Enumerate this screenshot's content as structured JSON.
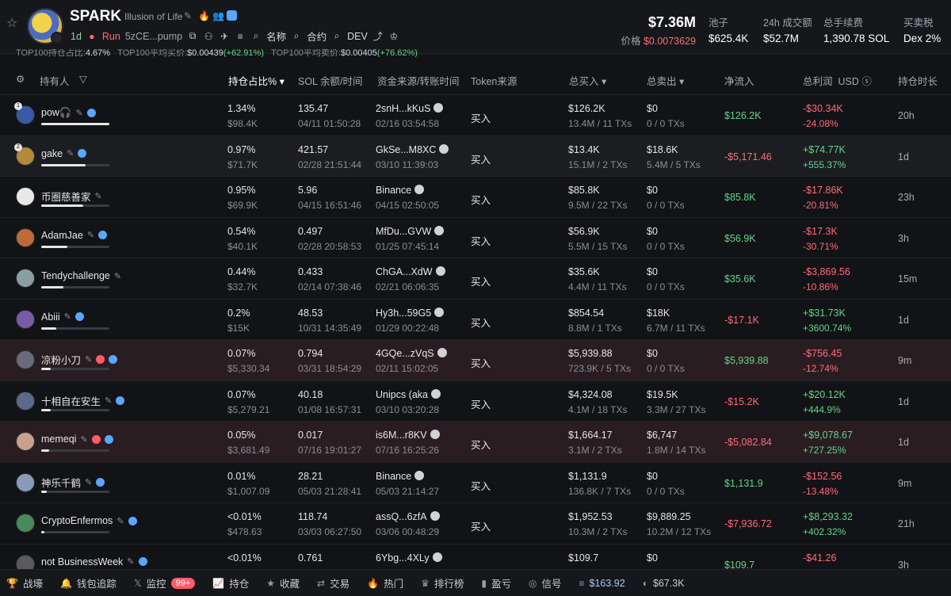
{
  "token": {
    "name": "SPARK",
    "subtitle": "Illusion of Life",
    "age": "1d",
    "run": "Run",
    "address": "5zCE...pump",
    "buttons": [
      "名称",
      "合约",
      "DEV"
    ]
  },
  "ticker_strip": {
    "part1_label": "TOP100持仓占比:",
    "part1_value": "4.67%",
    "part2_label": "TOP100平均买价:",
    "part2_value": "$0.00439",
    "part2_change": "(+62.91%)",
    "part3_label": "TOP100平均卖价:",
    "part3_value": "$0.00405",
    "part3_change": "(+76.62%)"
  },
  "market": {
    "mcap": "$7.36M",
    "price_label": "价格",
    "price": "$0.0073629",
    "stats": [
      {
        "label": "池子",
        "value": "$625.4K"
      },
      {
        "label": "24h 成交额",
        "value": "$52.7M"
      },
      {
        "label": "总手续费",
        "value": "1,390.78 SOL"
      },
      {
        "label": "买卖税",
        "value": "Dex 2%"
      }
    ]
  },
  "columns": {
    "holder": "持有人",
    "hold_pct": "持仓占比%",
    "sol_balance": "SOL 余额/时间",
    "fund_source": "资金来源/转账时间",
    "token_source": "Token来源",
    "total_buy": "总买入",
    "total_sell": "总卖出",
    "net_inflow": "净流入",
    "total_pnl": "总利润",
    "currency": "USD",
    "duration": "持仓时长"
  },
  "rows": [
    {
      "rank": "1",
      "name": "pow🎧",
      "pct": "1.34%",
      "pct_val": "$98.4K",
      "bar": 100,
      "sol": "135.47",
      "sol_time": "04/11 01:50:28",
      "src": "2snH...kKuS",
      "src_time": "02/16 03:54:58",
      "token_src": "买入",
      "buy": "$126.2K",
      "buy_sub": "13.4M / 11 TXs",
      "sell": "$0",
      "sell_sub": "0 / 0 TXs",
      "net": "$126.2K",
      "net_pos": true,
      "pnl": "-$30.34K",
      "pnl_pct": "-24.08%",
      "pnl_pos": false,
      "dur": "20h",
      "style": "",
      "avatar": "#3a5aa8",
      "red": false
    },
    {
      "rank": "2",
      "name": "gake",
      "pct": "0.97%",
      "pct_val": "$71.7K",
      "bar": 65,
      "sol": "421.57",
      "sol_time": "02/28 21:51:44",
      "src": "GkSe...M8XC",
      "src_time": "03/10 11:39:03",
      "token_src": "买入",
      "buy": "$13.4K",
      "buy_sub": "15.1M / 2 TXs",
      "sell": "$18.6K",
      "sell_sub": "5.4M / 5 TXs",
      "net": "-$5,171.46",
      "net_pos": false,
      "pnl": "+$74.77K",
      "pnl_pct": "+555.37%",
      "pnl_pos": true,
      "dur": "1d",
      "style": "alt",
      "avatar": "#b38a3a",
      "red": false
    },
    {
      "rank": "",
      "name": "币圈慈善家",
      "pct": "0.95%",
      "pct_val": "$69.9K",
      "bar": 62,
      "sol": "5.96",
      "sol_time": "04/15 16:51:46",
      "src": "Binance",
      "src_time": "04/15 02:50:05",
      "token_src": "买入",
      "buy": "$85.8K",
      "buy_sub": "9.5M / 22 TXs",
      "sell": "$0",
      "sell_sub": "0 / 0 TXs",
      "net": "$85.8K",
      "net_pos": true,
      "pnl": "-$17.86K",
      "pnl_pct": "-20.81%",
      "pnl_pos": false,
      "dur": "23h",
      "style": "",
      "avatar": "#e8e8e8",
      "red": false
    },
    {
      "rank": "",
      "name": "AdamJae",
      "pct": "0.54%",
      "pct_val": "$40.1K",
      "bar": 38,
      "sol": "0.497",
      "sol_time": "02/28 20:58:53",
      "src": "MfDu...GVW",
      "src_time": "01/25 07:45:14",
      "token_src": "买入",
      "buy": "$56.9K",
      "buy_sub": "5.5M / 15 TXs",
      "sell": "$0",
      "sell_sub": "0 / 0 TXs",
      "net": "$56.9K",
      "net_pos": true,
      "pnl": "-$17.3K",
      "pnl_pct": "-30.71%",
      "pnl_pos": false,
      "dur": "3h",
      "style": "",
      "avatar": "#c06a3a",
      "red": false
    },
    {
      "rank": "",
      "name": "Tendychallenge",
      "pct": "0.44%",
      "pct_val": "$32.7K",
      "bar": 32,
      "sol": "0.433",
      "sol_time": "02/14 07:38:46",
      "src": "ChGA...XdW",
      "src_time": "02/21 06:06:35",
      "token_src": "买入",
      "buy": "$35.6K",
      "buy_sub": "4.4M / 11 TXs",
      "sell": "$0",
      "sell_sub": "0 / 0 TXs",
      "net": "$35.6K",
      "net_pos": true,
      "pnl": "-$3,869.56",
      "pnl_pct": "-10.86%",
      "pnl_pos": false,
      "dur": "15m",
      "style": "",
      "avatar": "#8aa0a0",
      "red": false
    },
    {
      "rank": "",
      "name": "Abiii",
      "pct": "0.2%",
      "pct_val": "$15K",
      "bar": 22,
      "sol": "48.53",
      "sol_time": "10/31 14:35:49",
      "src": "Hy3h...59G5",
      "src_time": "01/29 00:22:48",
      "token_src": "买入",
      "buy": "$854.54",
      "buy_sub": "8.8M / 1 TXs",
      "sell": "$18K",
      "sell_sub": "6.7M / 11 TXs",
      "net": "-$17.1K",
      "net_pos": false,
      "pnl": "+$31.73K",
      "pnl_pct": "+3600.74%",
      "pnl_pos": true,
      "dur": "1d",
      "style": "",
      "avatar": "#7a5aa8",
      "red": false
    },
    {
      "rank": "",
      "name": "凉粉小刀",
      "pct": "0.07%",
      "pct_val": "$5,330.34",
      "bar": 14,
      "sol": "0.794",
      "sol_time": "03/31 18:54:29",
      "src": "4GQe...zVqS",
      "src_time": "02/11 15:02:05",
      "token_src": "买入",
      "buy": "$5,939.88",
      "buy_sub": "723.9K / 5 TXs",
      "sell": "$0",
      "sell_sub": "0 / 0 TXs",
      "net": "$5,939.88",
      "net_pos": true,
      "pnl": "-$756.45",
      "pnl_pct": "-12.74%",
      "pnl_pos": false,
      "dur": "9m",
      "style": "warn",
      "avatar": "#6a6a7a",
      "red": true
    },
    {
      "rank": "",
      "name": "十相自在安生",
      "pct": "0.07%",
      "pct_val": "$5,279.21",
      "bar": 14,
      "sol": "40.18",
      "sol_time": "01/08 16:57:31",
      "src": "Unipcs (aka",
      "src_time": "03/10 03:20:28",
      "token_src": "买入",
      "buy": "$4,324.08",
      "buy_sub": "4.1M / 18 TXs",
      "sell": "$19.5K",
      "sell_sub": "3.3M / 27 TXs",
      "net": "-$15.2K",
      "net_pos": false,
      "pnl": "+$20.12K",
      "pnl_pct": "+444.9%",
      "pnl_pos": true,
      "dur": "1d",
      "style": "",
      "avatar": "#5a6a8a",
      "red": false
    },
    {
      "rank": "",
      "name": "memeqi",
      "pct": "0.05%",
      "pct_val": "$3,681.49",
      "bar": 12,
      "sol": "0.017",
      "sol_time": "07/16 19:01:27",
      "src": "is6M...r8KV",
      "src_time": "07/16 16:25:26",
      "token_src": "买入",
      "buy": "$1,664.17",
      "buy_sub": "3.1M / 2 TXs",
      "sell": "$6,747",
      "sell_sub": "1.8M / 14 TXs",
      "net": "-$5,082.84",
      "net_pos": false,
      "pnl": "+$9,078.67",
      "pnl_pct": "+727.25%",
      "pnl_pos": true,
      "dur": "1d",
      "style": "warn",
      "avatar": "#c9a08a",
      "red": true
    },
    {
      "rank": "",
      "name": "神乐千鹤",
      "pct": "0.01%",
      "pct_val": "$1,007.09",
      "bar": 8,
      "sol": "28.21",
      "sol_time": "05/03 21:28:41",
      "src": "Binance",
      "src_time": "05/03 21:14:27",
      "token_src": "买入",
      "buy": "$1,131.9",
      "buy_sub": "136.8K / 7 TXs",
      "sell": "$0",
      "sell_sub": "0 / 0 TXs",
      "net": "$1,131.9",
      "net_pos": true,
      "pnl": "-$152.56",
      "pnl_pct": "-13.48%",
      "pnl_pos": false,
      "dur": "9m",
      "style": "",
      "avatar": "#8a9ab8",
      "red": false
    },
    {
      "rank": "",
      "name": "CryptoEnfermos",
      "pct": "<0.01%",
      "pct_val": "$478.63",
      "bar": 5,
      "sol": "118.74",
      "sol_time": "03/03 06:27:50",
      "src": "assQ...6zfA",
      "src_time": "03/06 00:48:29",
      "token_src": "买入",
      "buy": "$1,952.53",
      "buy_sub": "10.3M / 2 TXs",
      "sell": "$9,889.25",
      "sell_sub": "10.2M / 12 TXs",
      "net": "-$7,936.72",
      "net_pos": false,
      "pnl": "+$8,293.32",
      "pnl_pct": "+402.32%",
      "pnl_pos": true,
      "dur": "21h",
      "style": "",
      "avatar": "#4a8a5a",
      "red": false
    },
    {
      "rank": "",
      "name": "not BusinessWeek",
      "pct": "<0.01%",
      "pct_val": "",
      "bar": 4,
      "sol": "0.761",
      "sol_time": "",
      "src": "6Ybg...4XLy",
      "src_time": "",
      "token_src": "",
      "buy": "$109.7",
      "buy_sub": "",
      "sell": "$0",
      "sell_sub": "",
      "net": "$109.7",
      "net_pos": true,
      "pnl": "-$41.26",
      "pnl_pct": "",
      "pnl_pos": false,
      "dur": "3h",
      "style": "",
      "avatar": "#5a5a5a",
      "red": false
    }
  ],
  "bottom_bar": [
    {
      "icon": "trophy-icon",
      "label": "战壕"
    },
    {
      "icon": "bell-icon",
      "label": "钱包追踪"
    },
    {
      "icon": "x-icon",
      "label": "监控",
      "badge": "99+"
    },
    {
      "icon": "chart-icon",
      "label": "持仓"
    },
    {
      "icon": "star-icon",
      "label": "收藏"
    },
    {
      "icon": "swap-icon",
      "label": "交易"
    },
    {
      "icon": "fire-icon",
      "label": "热门"
    },
    {
      "icon": "rank-icon",
      "label": "排行榜"
    },
    {
      "icon": "pnl-icon",
      "label": "盈亏"
    },
    {
      "icon": "signal-icon",
      "label": "信号"
    },
    {
      "icon": "sol-icon",
      "label": "$163.92"
    },
    {
      "icon": "pill-icon",
      "label": "$67.3K"
    }
  ]
}
